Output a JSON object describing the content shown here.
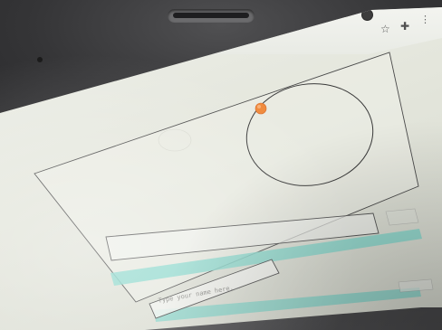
{
  "toolbar": {
    "profile_icon": "profile-icon",
    "bookmark_icon": "star-icon",
    "extensions_icon": "puzzle-icon",
    "menu_icon": "more-vert-icon"
  },
  "canvas": {
    "orbit_color": "#3a3a3a",
    "planet_color": "#f08a3c",
    "accent_teal": "#7fd3c8"
  },
  "input": {
    "text_input_placeholder": "Type your name here..."
  }
}
